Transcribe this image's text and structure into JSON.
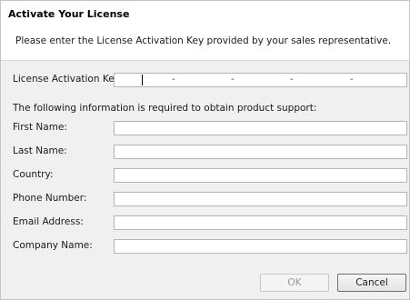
{
  "header": {
    "title": "Activate Your License",
    "description": "Please enter the License Activation Key provided by your sales representative."
  },
  "license": {
    "label": "License Activation Key:",
    "separators": [
      "-",
      "-",
      "-",
      "-"
    ],
    "value": ""
  },
  "info_text": "The following information is required to obtain product support:",
  "fields": {
    "first_name": {
      "label": "First Name:",
      "value": ""
    },
    "last_name": {
      "label": "Last Name:",
      "value": ""
    },
    "country": {
      "label": "Country:",
      "value": ""
    },
    "phone": {
      "label": "Phone Number:",
      "value": ""
    },
    "email": {
      "label": "Email Address:",
      "value": ""
    },
    "company": {
      "label": "Company Name:",
      "value": ""
    }
  },
  "buttons": {
    "ok_label": "OK",
    "ok_enabled": false,
    "cancel_label": "Cancel"
  }
}
